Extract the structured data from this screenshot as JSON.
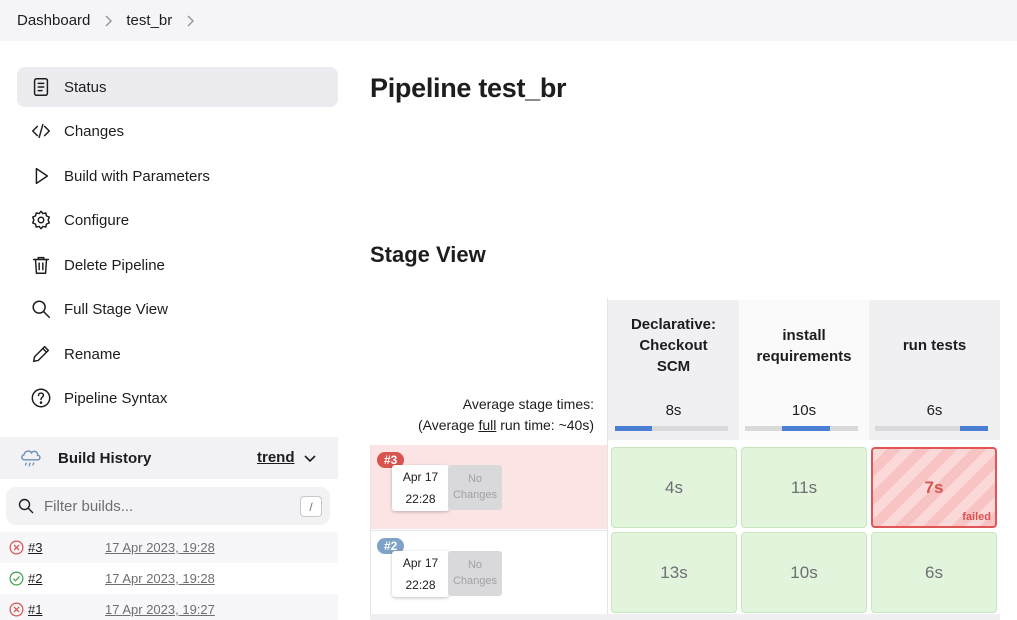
{
  "breadcrumb": [
    "Dashboard",
    "test_br"
  ],
  "sidebar": {
    "items": [
      {
        "label": "Status",
        "icon": "document-icon"
      },
      {
        "label": "Changes",
        "icon": "code-icon"
      },
      {
        "label": "Build with Parameters",
        "icon": "play-icon"
      },
      {
        "label": "Configure",
        "icon": "gear-icon"
      },
      {
        "label": "Delete Pipeline",
        "icon": "trash-icon"
      },
      {
        "label": "Full Stage View",
        "icon": "search-icon"
      },
      {
        "label": "Rename",
        "icon": "pencil-icon"
      },
      {
        "label": "Pipeline Syntax",
        "icon": "help-icon"
      }
    ]
  },
  "build_history": {
    "title": "Build History",
    "trend": "trend",
    "filter_placeholder": "Filter builds...",
    "shortcut": "/",
    "builds": [
      {
        "number": "#3",
        "date": "17 Apr 2023, 19:28",
        "status": "failed"
      },
      {
        "number": "#2",
        "date": "17 Apr 2023, 19:28",
        "status": "success"
      },
      {
        "number": "#1",
        "date": "17 Apr 2023, 19:27",
        "status": "failed"
      }
    ]
  },
  "main": {
    "title": "Pipeline test_br",
    "stage_view_title": "Stage View",
    "avg_label_1": "Average stage times:",
    "avg_label_2_prefix": "(Average ",
    "avg_label_2_link": "full",
    "avg_label_2_suffix": " run time: ~40s)"
  },
  "stages": [
    {
      "name_lines": [
        "Declarative:",
        "Checkout",
        "SCM"
      ],
      "avg": "8s",
      "avg_fraction": 0.33
    },
    {
      "name_lines": [
        "install",
        "requirements"
      ],
      "avg": "10s",
      "avg_fraction": 0.42
    },
    {
      "name_lines": [
        "run tests"
      ],
      "avg": "6s",
      "avg_fraction": 0.25
    }
  ],
  "runs": [
    {
      "badge": "#3",
      "badge_color": "#d9534f",
      "date": "Apr 17",
      "time": "22:28",
      "changes_lines": [
        "No",
        "Changes"
      ],
      "status": "failed",
      "row_color": "#fde4e4",
      "durations": [
        "4s",
        "11s",
        "7s"
      ],
      "stage_status": [
        "success",
        "success",
        "failed"
      ],
      "failed_label": "failed"
    },
    {
      "badge": "#2",
      "badge_color": "#7fa2c8",
      "date": "Apr 17",
      "time": "22:28",
      "changes_lines": [
        "No",
        "Changes"
      ],
      "status": "success",
      "row_color": "#ffffff",
      "durations": [
        "13s",
        "10s",
        "6s"
      ],
      "stage_status": [
        "success",
        "success",
        "success"
      ]
    }
  ]
}
